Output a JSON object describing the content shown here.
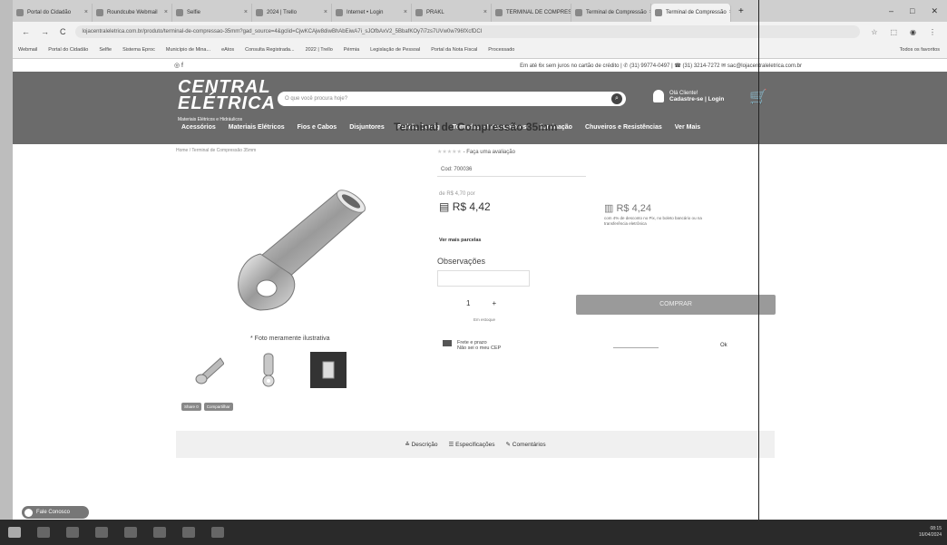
{
  "browser": {
    "tabs": [
      {
        "label": "Portal do Cidadão",
        "active": false
      },
      {
        "label": "Roundcube Webmail",
        "active": false
      },
      {
        "label": "Selfie",
        "active": false
      },
      {
        "label": "2024 | Trello",
        "active": false
      },
      {
        "label": "Internet • Login",
        "active": false
      },
      {
        "label": "PRAKL",
        "active": false
      },
      {
        "label": "TERMINAL DE COMPRESSÃO",
        "active": false
      },
      {
        "label": "Terminal de Compressão",
        "active": false
      },
      {
        "label": "Terminal de Compressão",
        "active": true
      }
    ],
    "url": "lojacentraleletrica.com.br/produto/terminal-de-compressao-35mm?gad_source=4&gclid=CjwKCAjw8diwBhAbEiwA7i_sJOfbAxV2_5BbafKOy7i7zs7UVw0w796fXcfDCI",
    "bookmarks": [
      "Webmail",
      "Portal do Cidadão",
      "Selfie",
      "Sistema Eproc",
      "Município de Mina...",
      "eAtos",
      "Consulta Registrada...",
      "2022 | Trello",
      "Pérmia",
      "Legislação de Pessoal",
      "Portal da Nota Fiscal",
      "Processado"
    ],
    "all_bookmarks": "Todos os favoritos"
  },
  "store": {
    "topline": "Em até 6x sem juros no cartão de crédito | ✆ (31) 99774-0497 | ☎ (31) 3214-7272  ✉ sac@lojacentraleletrica.com.br",
    "logo_line1": "CENTRAL",
    "logo_line2": "ELÉTRICA",
    "logo_tagline": "Materiais Elétricos e Hidráulicos",
    "search_placeholder": "O que você procura hoje?",
    "user_greeting": "Olá Cliente!",
    "user_links": "Cadastre-se | Login",
    "menu": [
      "Acessórios",
      "Materiais Elétricos",
      "Fios e Cabos",
      "Disjuntores",
      "Padrão Cemig",
      "Tomadas e Interruptores",
      "Iluminação",
      "Chuveiros e Resistências",
      "Ver Mais"
    ],
    "breadcrumb": "Home  /  Terminal de Compressão 35mm"
  },
  "product": {
    "title": "Terminal de Compressão 35mm",
    "rating_text": "- Faça uma avaliação",
    "code": "Cod: 700036",
    "old_price": "de R$ 4,70 por",
    "price": "R$ 4,42",
    "pix_price": "R$ 4,24",
    "pix_note": "com 4% de desconto no Pix, no boleto bancário ou na transferência eletrônica",
    "installments_link": "Ver mais parcelas",
    "obs_label": "Observações",
    "qty": "1",
    "qty_plus": "+",
    "stock": "Em estoque",
    "buy": "COMPRAR",
    "shipping_title": "Frete e prazo",
    "shipping_sub": "Não sei o meu CEP",
    "ok": "Ok",
    "photo_note": "* Foto meramente ilustrativa",
    "share_fb": "Share 0",
    "share_wa": "Compartilhar",
    "tabs": [
      "Descrição",
      "Especificações",
      "Comentários"
    ]
  },
  "chat_label": "Fale Conosco",
  "clock": {
    "time": "08:15",
    "date": "16/04/2024"
  }
}
